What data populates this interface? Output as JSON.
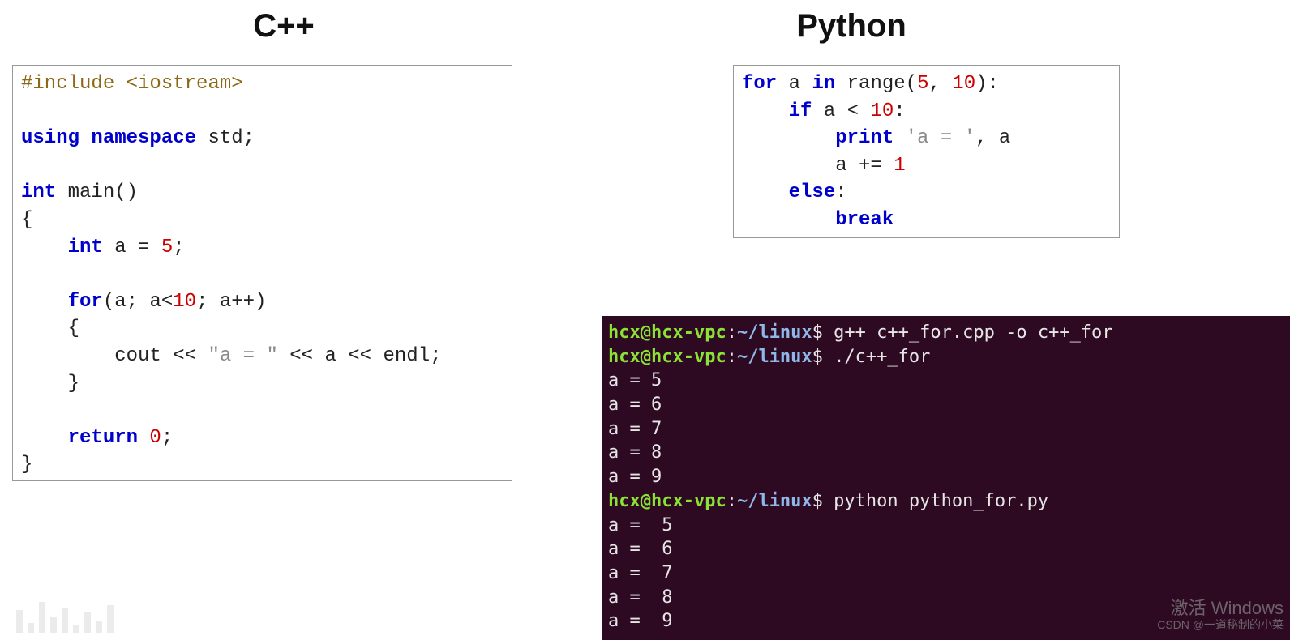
{
  "headings": {
    "cpp": "C++",
    "python": "Python"
  },
  "cpp_code": {
    "l1_include": "#include",
    "l1_header": "<iostream>",
    "l3_using": "using",
    "l3_namespace": "namespace",
    "l3_std": "std;",
    "l5_int": "int",
    "l5_main": "main()",
    "l6_brace": "{",
    "l7_int": "int",
    "l7_assign": "a = ",
    "l7_num": "5",
    "l7_semi": ";",
    "l9_for": "for",
    "l9_open": "(a; a<",
    "l9_num": "10",
    "l9_close": "; a++)",
    "l10_brace": "{",
    "l11_cout": "cout << ",
    "l11_str": "\"a = \"",
    "l11_rest": " << a << endl;",
    "l12_brace": "}",
    "l14_return": "return",
    "l14_zero": " 0",
    "l14_semi": ";",
    "l15_brace": "}"
  },
  "py_code": {
    "l1_for": "for",
    "l1_a": " a ",
    "l1_in": "in",
    "l1_range": " range(",
    "l1_n5": "5",
    "l1_comma": ", ",
    "l1_n10": "10",
    "l1_close": "):",
    "l2_if": "if",
    "l2_cond": " a < ",
    "l2_n10": "10",
    "l2_colon": ":",
    "l3_print": "print",
    "l3_str": " 'a = '",
    "l3_rest": ", a",
    "l4_aplus": "a += ",
    "l4_one": "1",
    "l5_else": "else",
    "l5_colon": ":",
    "l6_break": "break"
  },
  "terminal": {
    "prompt_user": "hcx@hcx-vpc",
    "prompt_sep": ":",
    "prompt_path": "~/linux",
    "prompt_end": "$ ",
    "cmd1": "g++ c++_for.cpp -o c++_for",
    "cmd2": "./c++_for",
    "out1": [
      "a = 5",
      "a = 6",
      "a = 7",
      "a = 8",
      "a = 9"
    ],
    "cmd3": "python python_for.py",
    "out2": [
      "a =  5",
      "a =  6",
      "a =  7",
      "a =  8",
      "a =  9"
    ]
  },
  "watermark": {
    "line1": "激活 Windows",
    "line2": "CSDN @一道秘制的小菜"
  }
}
